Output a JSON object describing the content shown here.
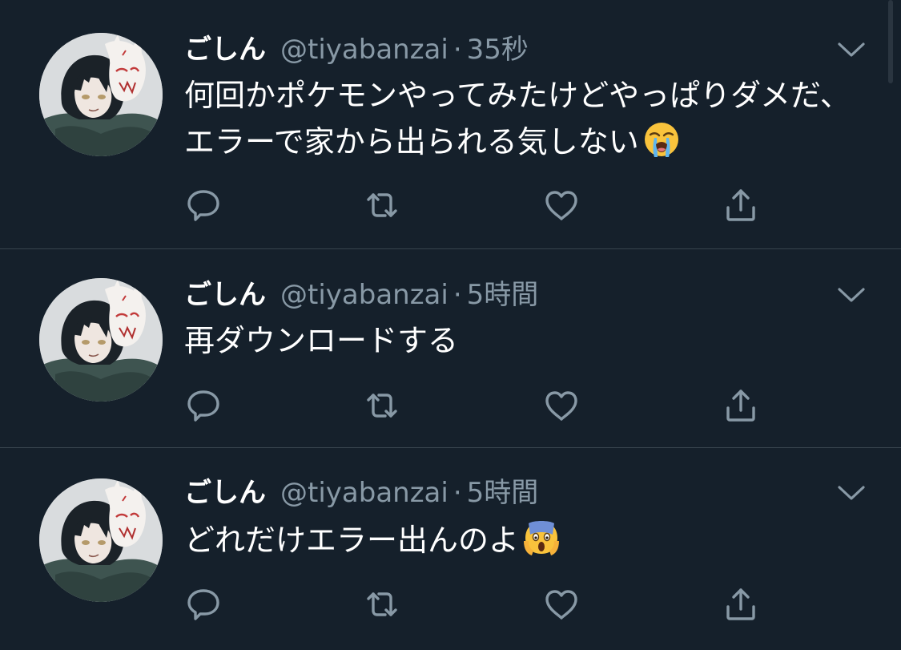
{
  "colors": {
    "background": "#15202b",
    "divider": "#38444d",
    "primary_text": "#ffffff",
    "secondary_text": "#8899a6",
    "icon": "#8899a6"
  },
  "tweets": [
    {
      "display_name": "ごしん",
      "handle": "@tiyabanzai",
      "separator": "·",
      "time": "35秒",
      "text": "何回かポケモンやってみたけどやっぱりダメだ、エラーで家から出られる気しない",
      "emoji": "loudly-crying-face",
      "actions": [
        "reply-icon",
        "retweet-icon",
        "like-icon",
        "share-icon"
      ]
    },
    {
      "display_name": "ごしん",
      "handle": "@tiyabanzai",
      "separator": "·",
      "time": "5時間",
      "text": "再ダウンロードする",
      "emoji": "",
      "actions": [
        "reply-icon",
        "retweet-icon",
        "like-icon",
        "share-icon"
      ]
    },
    {
      "display_name": "ごしん",
      "handle": "@tiyabanzai",
      "separator": "·",
      "time": "5時間",
      "text": "どれだけエラー出んのよ",
      "emoji": "face-screaming-in-fear",
      "actions": [
        "reply-icon",
        "retweet-icon",
        "like-icon",
        "share-icon"
      ]
    }
  ]
}
